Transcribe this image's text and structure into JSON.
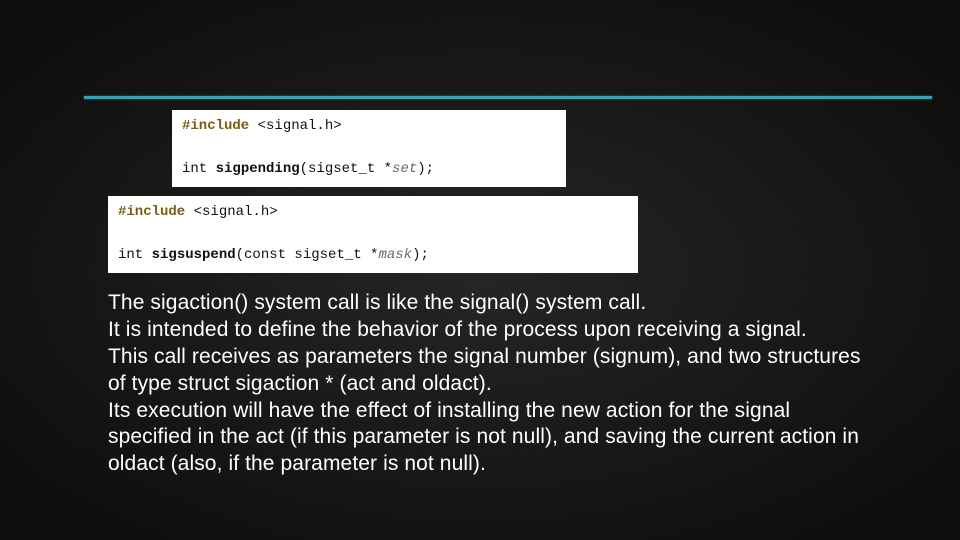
{
  "rule": true,
  "code_blocks": [
    {
      "include_kw": "#include",
      "include_hdr": " <signal.h>",
      "sig_ret": "int ",
      "sig_fn": "sigpending",
      "sig_open": "(sigset_t *",
      "sig_param": "set",
      "sig_close": ");"
    },
    {
      "include_kw": "#include",
      "include_hdr": " <signal.h>",
      "sig_ret": "int ",
      "sig_fn": "sigsuspend",
      "sig_open": "(const sigset_t *",
      "sig_param": "mask",
      "sig_close": ");"
    }
  ],
  "body": {
    "p1": "The sigaction() system call is like the signal() system call.",
    "p2": "It is intended to define the behavior of the process upon receiving a signal.",
    "p3": "This call receives as parameters the signal number (signum), and two structures of type struct sigaction * (act and oldact).",
    "p4": "Its execution will have the effect of installing the new action for the signal specified in the act (if this parameter is not null), and saving the current action in oldact (also, if the parameter is not null)."
  }
}
